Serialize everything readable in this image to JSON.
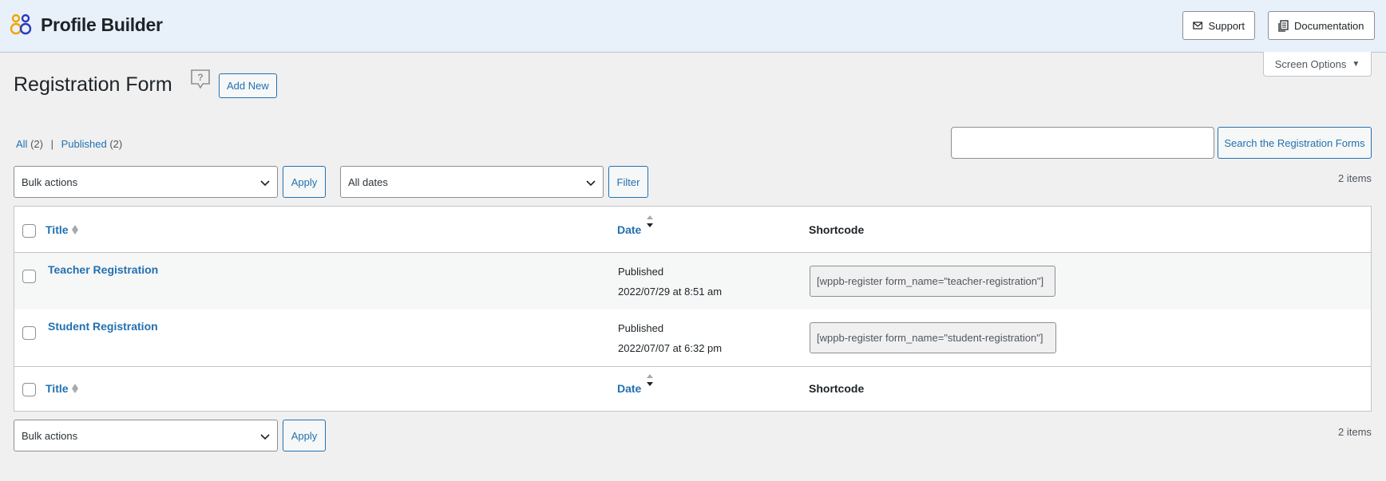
{
  "header": {
    "app_title": "Profile Builder",
    "support_label": "Support",
    "docs_label": "Documentation",
    "logo_icon": "profile-builder-logo-icon",
    "accent_color": "#2271b1"
  },
  "screen_options": {
    "label": "Screen Options"
  },
  "page": {
    "title": "Registration Form",
    "add_new_label": "Add New"
  },
  "views": {
    "all_label": "All",
    "all_count": "(2)",
    "separator": "|",
    "published_label": "Published",
    "published_count": "(2)"
  },
  "search": {
    "value": "",
    "button_label": "Search the Registration Forms"
  },
  "tablenav_top": {
    "bulk_actions": "Bulk actions",
    "apply_label": "Apply",
    "dates_filter": "All dates",
    "filter_label": "Filter",
    "items_count": "2 items"
  },
  "tablenav_bottom": {
    "bulk_actions": "Bulk actions",
    "apply_label": "Apply",
    "items_count": "2 items"
  },
  "table": {
    "columns": {
      "title": "Title",
      "date": "Date",
      "shortcode": "Shortcode"
    },
    "rows": [
      {
        "title": "Teacher Registration",
        "status": "Published",
        "date": "2022/07/29 at 8:51 am",
        "shortcode": "[wppb-register form_name=\"teacher-registration\"]"
      },
      {
        "title": "Student Registration",
        "status": "Published",
        "date": "2022/07/07 at 6:32 pm",
        "shortcode": "[wppb-register form_name=\"student-registration\"]"
      }
    ]
  }
}
